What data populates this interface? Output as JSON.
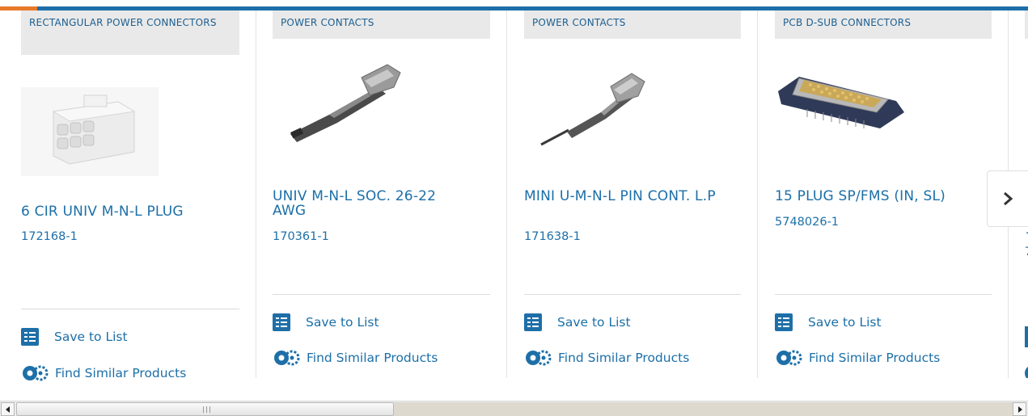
{
  "colors": {
    "accent_blue": "#1e6fa8",
    "accent_orange": "#e8792b",
    "link_blue": "#1c6fa8",
    "category_bg": "#e9e9e9"
  },
  "products": [
    {
      "category": "RECTANGULAR POWER CONNECTORS",
      "title": "6 CIR UNIV M-N-L PLUG",
      "part_number": "172168-1",
      "save_label": "Save to List",
      "similar_label": "Find Similar Products",
      "image_icon": "rectangular-connector-housing-icon"
    },
    {
      "category": "POWER CONTACTS",
      "title": "UNIV M-N-L SOC. 26-22 AWG",
      "part_number": "170361-1",
      "save_label": "Save to List",
      "similar_label": "Find Similar Products",
      "image_icon": "socket-contact-icon"
    },
    {
      "category": "POWER CONTACTS",
      "title": "MINI U-M-N-L PIN CONT. L.P",
      "part_number": "171638-1",
      "save_label": "Save to List",
      "similar_label": "Find Similar Products",
      "image_icon": "pin-contact-icon"
    },
    {
      "category": "PCB D-SUB CONNECTORS",
      "title": "15 PLUG SP/FMS (IN, SL)",
      "part_number": "5748026-1",
      "save_label": "Save to List",
      "similar_label": "Find Similar Products",
      "image_icon": "d-sub-connector-icon"
    }
  ],
  "partial_card": {
    "title_fragment": "1",
    "part_fragment": "7"
  },
  "navigation": {
    "next_icon": "chevron-right-icon"
  },
  "scrollbar": {
    "left_icon": "arrow-left-icon",
    "right_icon": "arrow-right-icon"
  }
}
